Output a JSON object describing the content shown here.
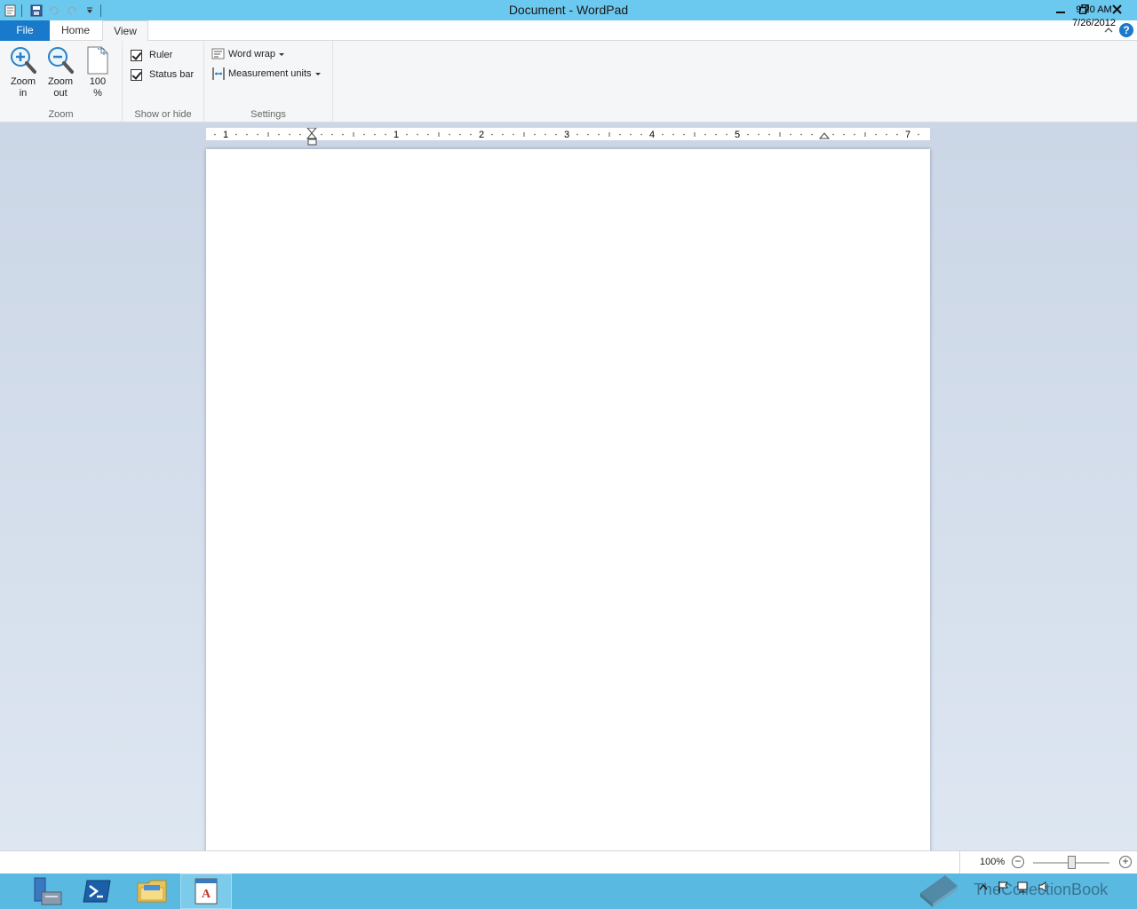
{
  "window": {
    "title": "Document - WordPad"
  },
  "tabs": {
    "file": "File",
    "home": "Home",
    "view": "View"
  },
  "ribbon": {
    "zoom": {
      "label": "Zoom",
      "zoom_in": "Zoom\nin",
      "zoom_out": "Zoom\nout",
      "hundred": "100\n%"
    },
    "show_hide": {
      "label": "Show or hide",
      "ruler": "Ruler",
      "status_bar": "Status bar"
    },
    "settings": {
      "label": "Settings",
      "word_wrap": "Word wrap",
      "measurement_units": "Measurement units"
    }
  },
  "ruler": {
    "numbers": [
      "1",
      "1",
      "2",
      "3",
      "4",
      "5",
      "7"
    ]
  },
  "status": {
    "zoom": "100%"
  },
  "taskbar": {
    "time": "9:20 AM",
    "date": "7/26/2012"
  },
  "watermark": {
    "text": "TheCollectionBook"
  },
  "colors": {
    "titlebar": "#6bc8ee",
    "file_tab": "#1979ca",
    "taskbar": "#5ab9e0"
  }
}
